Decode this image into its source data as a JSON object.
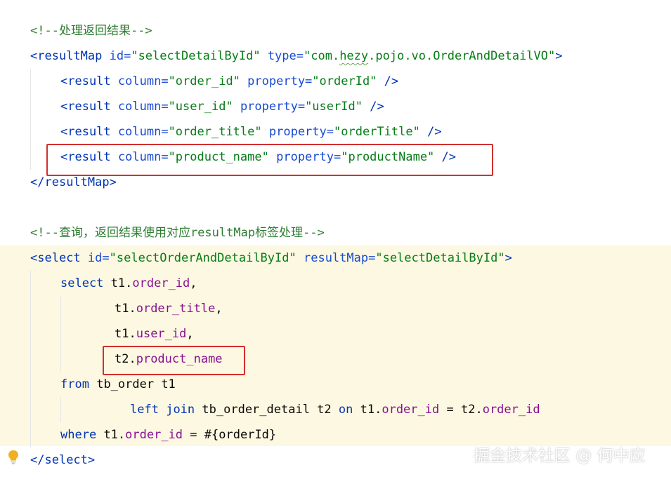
{
  "colors": {
    "comment": "#2e7d32",
    "tag": "#0033b3",
    "attribute": "#174ad4",
    "value": "#067d17",
    "keyword": "#0033b3",
    "column": "#871094",
    "highlight_bg": "#fdf8e1",
    "box": "#d32f2f"
  },
  "code": {
    "comment1": "<!--处理返回结果-->",
    "rm_open": "<resultMap",
    "rm_id_attr": "id=",
    "rm_id_val": "\"selectDetailById\"",
    "rm_type_attr": "type=",
    "rm_type_q": "\"com.",
    "rm_type_squig": "hezy",
    "rm_type_rest": ".pojo.vo.OrderAndDetailVO\"",
    "rm_close_bracket": ">",
    "rows": [
      {
        "tag": "<result",
        "col_attr": "column=",
        "col_val": "\"order_id\"",
        "prop_attr": "property=",
        "prop_val": "\"orderId\"",
        "end": "/>"
      },
      {
        "tag": "<result",
        "col_attr": "column=",
        "col_val": "\"user_id\"",
        "prop_attr": "property=",
        "prop_val": "\"userId\"",
        "end": "/>"
      },
      {
        "tag": "<result",
        "col_attr": "column=",
        "col_val": "\"order_title\"",
        "prop_attr": "property=",
        "prop_val": "\"orderTitle\"",
        "end": "/>"
      },
      {
        "tag": "<result",
        "col_attr": "column=",
        "col_val": "\"product_name\"",
        "prop_attr": "property=",
        "prop_val": "\"productName\"",
        "end": "/>"
      }
    ],
    "rm_end_lt": "</",
    "rm_end_name": "resultMap",
    "rm_end_gt": ">",
    "comment2": "<!--查询，返回结果使用对应resultMap标签处理-->",
    "sel_open": "<select",
    "sel_id_attr": "id=",
    "sel_id_val": "\"selectOrderAndDetailById\"",
    "sel_rm_attr": "resultMap=",
    "sel_rm_val": "\"selectDetailById\"",
    "sel_gt": ">",
    "kw_select": "select",
    "t1": "t1.",
    "t2": "t2.",
    "col_order_id": "order_id",
    "col_order_title": "order_title",
    "col_user_id": "user_id",
    "col_product_name": "product_name",
    "comma": ",",
    "kw_from": "from",
    "from_rest": "tb_order t1",
    "kw_left": "left",
    "kw_join": "join",
    "join_table": "tb_order_detail t2",
    "kw_on": "on",
    "eq": "=",
    "kw_where": "where",
    "param": "#{orderId}",
    "sel_end_lt": "</",
    "sel_end_name": "select",
    "sel_end_gt": ">"
  },
  "watermark": "掘金技术社区 @ 何中应"
}
